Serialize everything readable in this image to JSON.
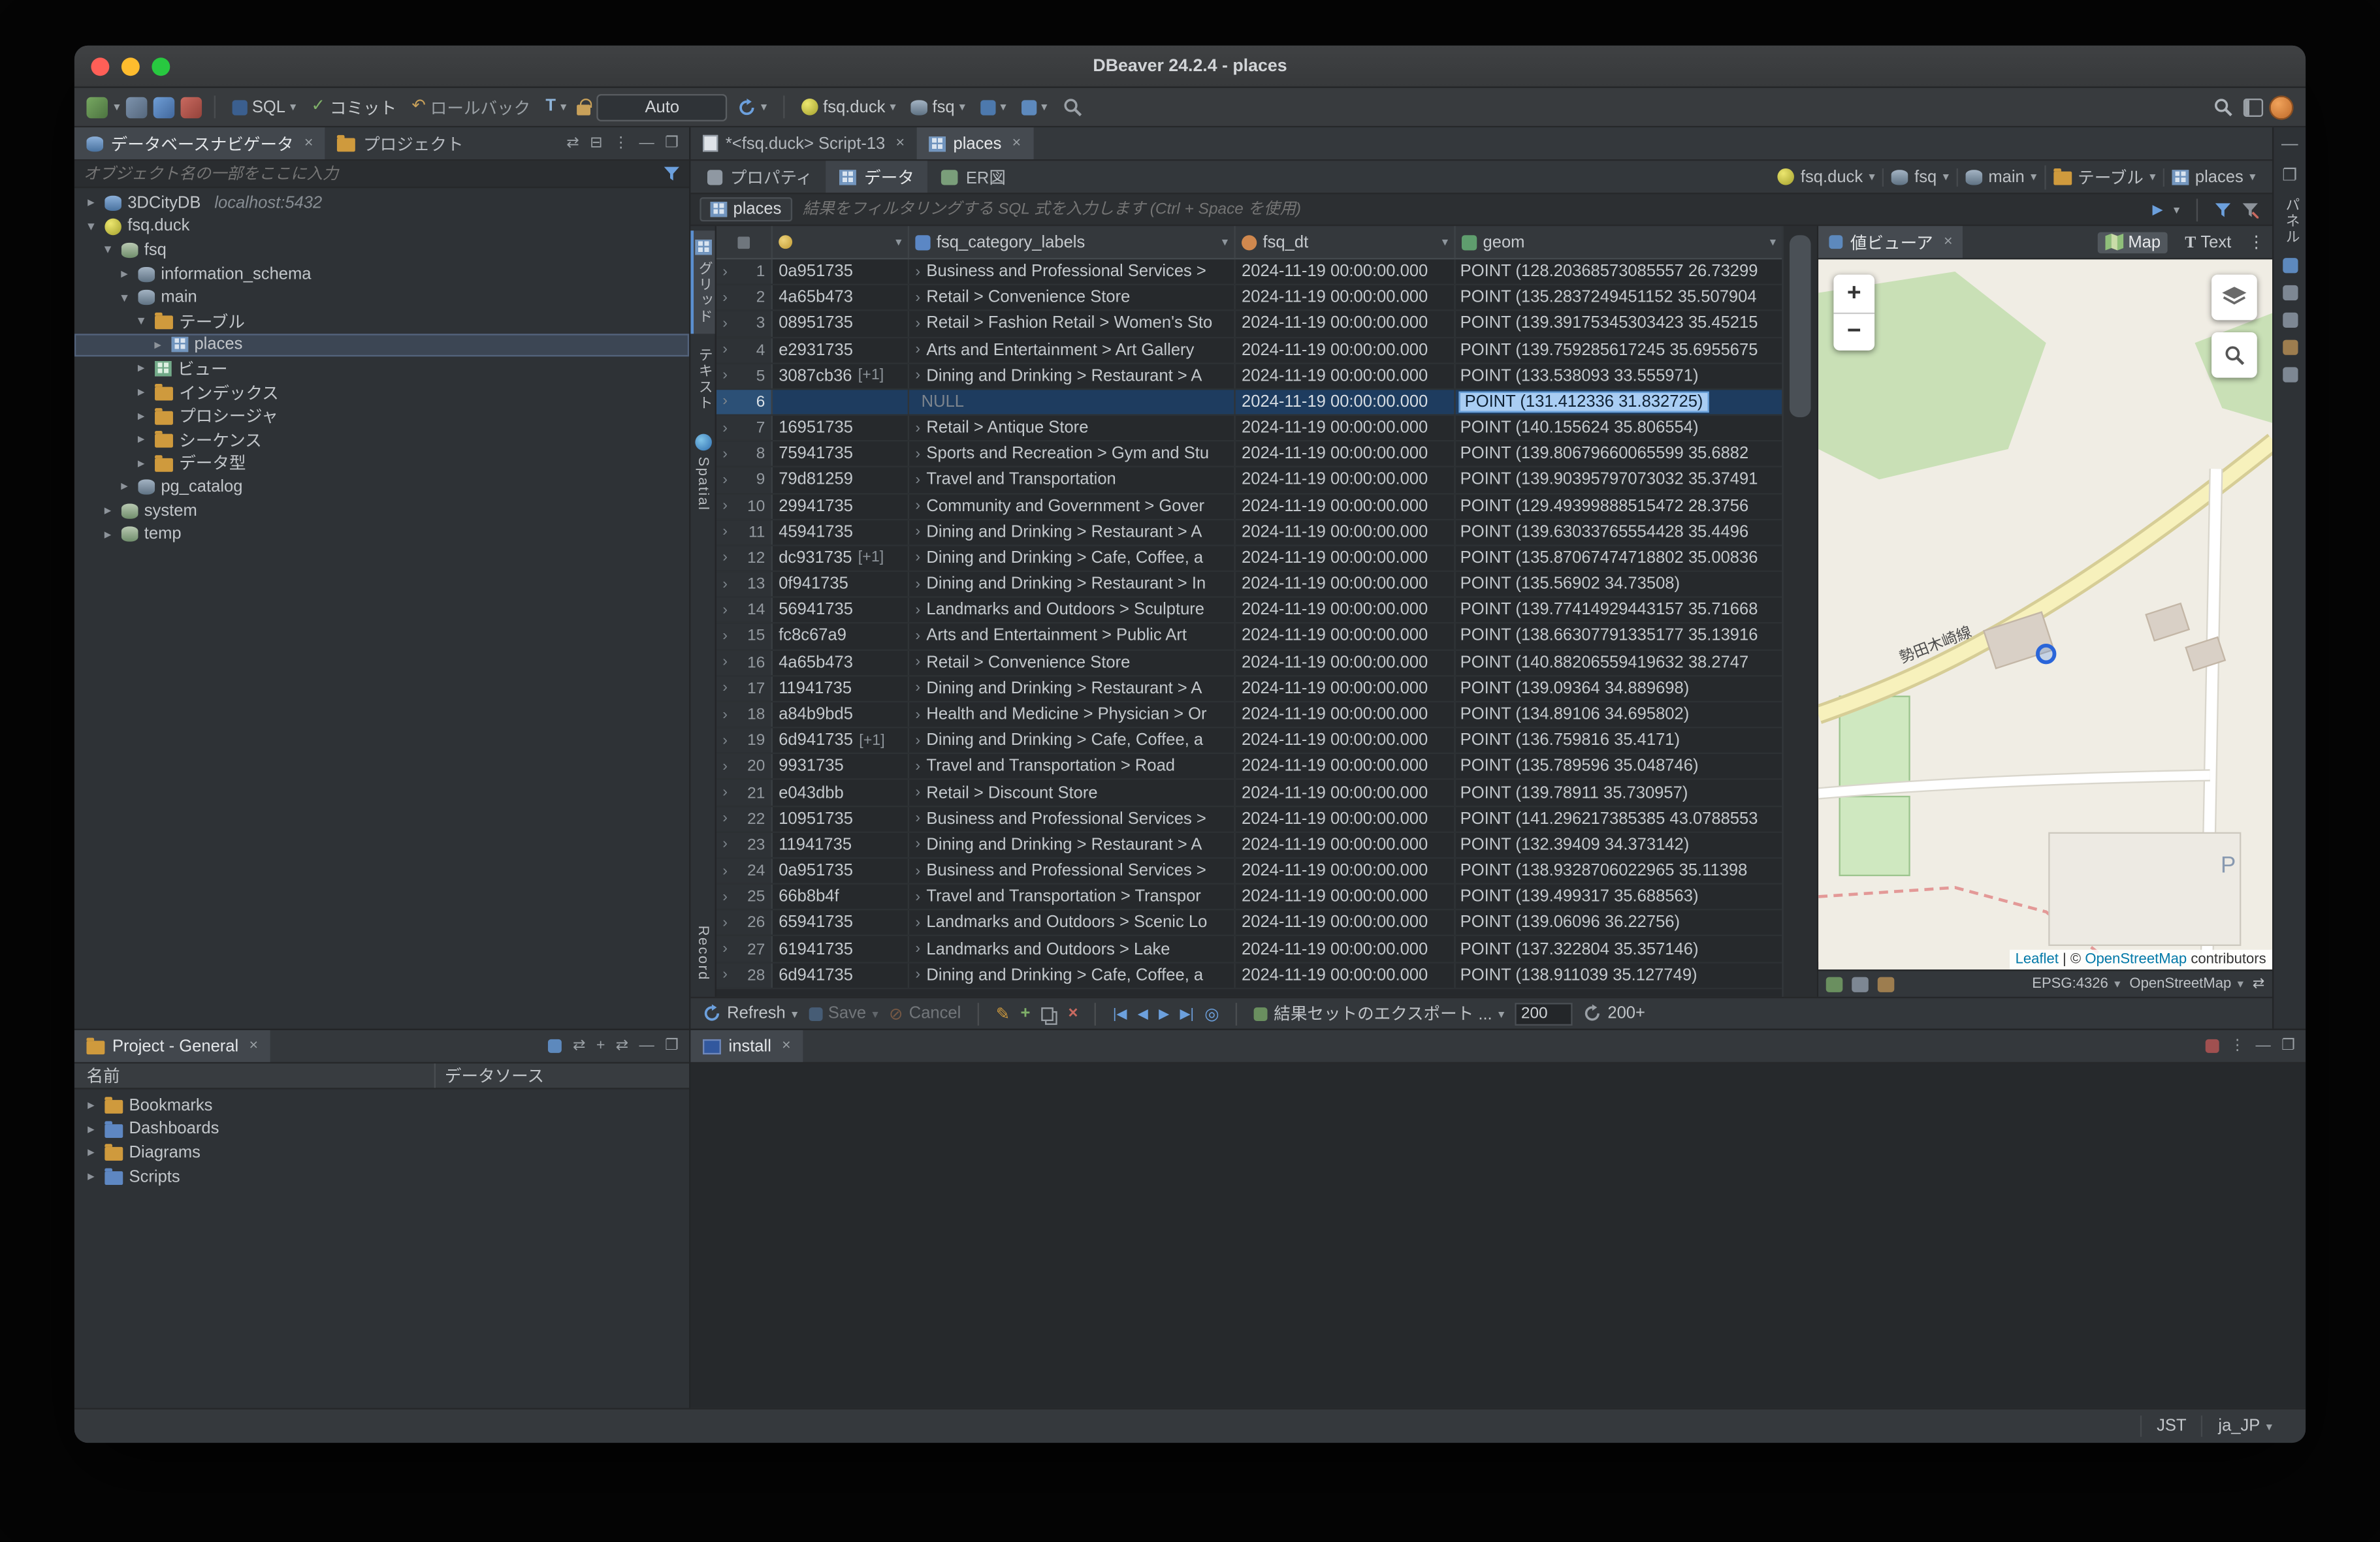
{
  "window": {
    "title": "DBeaver 24.2.4 - places"
  },
  "toolbar": {
    "sql": "SQL",
    "commit": "コミット",
    "rollback": "ロールバック",
    "auto": "Auto",
    "database": "fsq.duck",
    "schema": "fsq"
  },
  "navigator": {
    "tab_database": "データベースナビゲータ",
    "tab_project": "プロジェクト",
    "filter_placeholder": "オブジェクト名の一部をここに入力",
    "tree": [
      {
        "label": "3DCityDB",
        "suffix": "localhost:5432",
        "depth": 0,
        "icon": "db",
        "arrow": "collapsed"
      },
      {
        "label": "fsq.duck",
        "depth": 0,
        "icon": "duck",
        "arrow": "expanded"
      },
      {
        "label": "fsq",
        "depth": 1,
        "icon": "db2",
        "arrow": "expanded"
      },
      {
        "label": "information_schema",
        "depth": 2,
        "icon": "schema",
        "arrow": "collapsed"
      },
      {
        "label": "main",
        "depth": 2,
        "icon": "schema",
        "arrow": "expanded"
      },
      {
        "label": "テーブル",
        "depth": 3,
        "icon": "folder-table",
        "arrow": "expanded"
      },
      {
        "label": "places",
        "depth": 4,
        "icon": "table",
        "arrow": "collapsed",
        "cls": "selected"
      },
      {
        "label": "ビュー",
        "depth": 3,
        "icon": "view",
        "arrow": "collapsed"
      },
      {
        "label": "インデックス",
        "depth": 3,
        "icon": "folder",
        "arrow": "collapsed"
      },
      {
        "label": "プロシージャ",
        "depth": 3,
        "icon": "folder",
        "arrow": "collapsed"
      },
      {
        "label": "シーケンス",
        "depth": 3,
        "icon": "folder",
        "arrow": "collapsed"
      },
      {
        "label": "データ型",
        "depth": 3,
        "icon": "folder",
        "arrow": "collapsed"
      },
      {
        "label": "pg_catalog",
        "depth": 2,
        "icon": "schema",
        "arrow": "collapsed"
      },
      {
        "label": "system",
        "depth": 1,
        "icon": "db2",
        "arrow": "collapsed"
      },
      {
        "label": "temp",
        "depth": 1,
        "icon": "db2",
        "arrow": "collapsed"
      }
    ]
  },
  "editor": {
    "tab_script": "*<fsq.duck> Script-13",
    "tab_places": "places",
    "subtabs": {
      "properties": "プロパティ",
      "data": "データ",
      "er": "ER図"
    },
    "breadcrumb": [
      {
        "label": "fsq.duck",
        "icon": "duck"
      },
      {
        "label": "fsq",
        "icon": "schema"
      },
      {
        "label": "main",
        "icon": "schema"
      },
      {
        "label": "テーブル",
        "icon": "folder-table"
      },
      {
        "label": "places",
        "icon": "table"
      }
    ],
    "filter": {
      "target": "places",
      "placeholder": "結果をフィルタリングする SQL 式を入力します (Ctrl + Space を使用)"
    }
  },
  "grid": {
    "side_tabs": {
      "grid": "グリッド",
      "text": "テキスト",
      "spatial": "Spatial",
      "record": "Record"
    },
    "columns": [
      {
        "name": "",
        "icon": "key"
      },
      {
        "name": "fsq_category_labels",
        "icon": "col-text"
      },
      {
        "name": "fsq_dt",
        "icon": "col-date"
      },
      {
        "name": "geom",
        "icon": "col-geom"
      }
    ],
    "rows": [
      {
        "n": "1",
        "id": "0a951735",
        "badge": "",
        "tw": "›",
        "cat": "Business and Professional Services >",
        "dt": "2024-11-19 00:00:00.000",
        "geom": "POINT (128.20368573085557 26.73299"
      },
      {
        "n": "2",
        "id": "4a65b473",
        "badge": "",
        "tw": "›",
        "cat": "Retail > Convenience Store",
        "dt": "2024-11-19 00:00:00.000",
        "geom": "POINT (135.2837249451152 35.507904"
      },
      {
        "n": "3",
        "id": "08951735",
        "badge": "",
        "tw": "›",
        "cat": "Retail > Fashion Retail > Women's Sto",
        "dt": "2024-11-19 00:00:00.000",
        "geom": "POINT (139.39175345303423 35.45215"
      },
      {
        "n": "4",
        "id": "e2931735",
        "badge": "",
        "tw": "›",
        "cat": "Arts and Entertainment > Art Gallery",
        "dt": "2024-11-19 00:00:00.000",
        "geom": "POINT (139.759285617245 35.6955675"
      },
      {
        "n": "5",
        "id": "3087cb36",
        "badge": "[+1]",
        "tw": "›",
        "cat": "Dining and Drinking > Restaurant > A",
        "dt": "2024-11-19 00:00:00.000",
        "geom": "POINT (133.538093 33.555971)"
      },
      {
        "n": "6",
        "id": "",
        "badge": "",
        "tw": "",
        "cat": "NULL",
        "cat_cls": "null-val",
        "dt": "2024-11-19 00:00:00.000",
        "geom": "POINT (131.412336 31.832725)",
        "cls": "row-selected",
        "geom_cls": "cell-selected"
      },
      {
        "n": "7",
        "id": "16951735",
        "badge": "",
        "tw": "›",
        "cat": "Retail > Antique Store",
        "dt": "2024-11-19 00:00:00.000",
        "geom": "POINT (140.155624 35.806554)"
      },
      {
        "n": "8",
        "id": "75941735",
        "badge": "",
        "tw": "›",
        "cat": "Sports and Recreation > Gym and Stu",
        "dt": "2024-11-19 00:00:00.000",
        "geom": "POINT (139.80679660065599 35.6882"
      },
      {
        "n": "9",
        "id": "79d81259",
        "badge": "",
        "tw": "›",
        "cat": "Travel and Transportation",
        "dt": "2024-11-19 00:00:00.000",
        "geom": "POINT (139.90395797073032 35.37491"
      },
      {
        "n": "10",
        "id": "29941735",
        "badge": "",
        "tw": "›",
        "cat": "Community and Government > Gover",
        "dt": "2024-11-19 00:00:00.000",
        "geom": "POINT (129.49399888515472 28.3756"
      },
      {
        "n": "11",
        "id": "45941735",
        "badge": "",
        "tw": "›",
        "cat": "Dining and Drinking > Restaurant > A",
        "dt": "2024-11-19 00:00:00.000",
        "geom": "POINT (139.63033765554428 35.4496"
      },
      {
        "n": "12",
        "id": "dc931735",
        "badge": "[+1]",
        "tw": "›",
        "cat": "Dining and Drinking > Cafe, Coffee, a",
        "dt": "2024-11-19 00:00:00.000",
        "geom": "POINT (135.87067474718802 35.00836"
      },
      {
        "n": "13",
        "id": "0f941735",
        "badge": "",
        "tw": "›",
        "cat": "Dining and Drinking > Restaurant > In",
        "dt": "2024-11-19 00:00:00.000",
        "geom": "POINT (135.56902 34.73508)"
      },
      {
        "n": "14",
        "id": "56941735",
        "badge": "",
        "tw": "›",
        "cat": "Landmarks and Outdoors > Sculpture",
        "dt": "2024-11-19 00:00:00.000",
        "geom": "POINT (139.77414929443157 35.71668"
      },
      {
        "n": "15",
        "id": "fc8c67a9",
        "badge": "",
        "tw": "›",
        "cat": "Arts and Entertainment > Public Art",
        "dt": "2024-11-19 00:00:00.000",
        "geom": "POINT (138.66307791335177 35.13916"
      },
      {
        "n": "16",
        "id": "4a65b473",
        "badge": "",
        "tw": "›",
        "cat": "Retail > Convenience Store",
        "dt": "2024-11-19 00:00:00.000",
        "geom": "POINT (140.88206559419632 38.2747"
      },
      {
        "n": "17",
        "id": "11941735",
        "badge": "",
        "tw": "›",
        "cat": "Dining and Drinking > Restaurant > A",
        "dt": "2024-11-19 00:00:00.000",
        "geom": "POINT (139.09364 34.889698)"
      },
      {
        "n": "18",
        "id": "a84b9bd5",
        "badge": "",
        "tw": "›",
        "cat": "Health and Medicine > Physician > Or",
        "dt": "2024-11-19 00:00:00.000",
        "geom": "POINT (134.89106 34.695802)"
      },
      {
        "n": "19",
        "id": "6d941735",
        "badge": "[+1]",
        "tw": "›",
        "cat": "Dining and Drinking > Cafe, Coffee, a",
        "dt": "2024-11-19 00:00:00.000",
        "geom": "POINT (136.759816 35.4171)"
      },
      {
        "n": "20",
        "id": "9931735",
        "badge": "",
        "tw": "›",
        "cat": "Travel and Transportation > Road",
        "dt": "2024-11-19 00:00:00.000",
        "geom": "POINT (135.789596 35.048746)"
      },
      {
        "n": "21",
        "id": "e043dbb",
        "badge": "",
        "tw": "›",
        "cat": "Retail > Discount Store",
        "dt": "2024-11-19 00:00:00.000",
        "geom": "POINT (139.78911 35.730957)"
      },
      {
        "n": "22",
        "id": "10951735",
        "badge": "",
        "tw": "›",
        "cat": "Business and Professional Services >",
        "dt": "2024-11-19 00:00:00.000",
        "geom": "POINT (141.296217385385 43.0788553"
      },
      {
        "n": "23",
        "id": "11941735",
        "badge": "",
        "tw": "›",
        "cat": "Dining and Drinking > Restaurant > A",
        "dt": "2024-11-19 00:00:00.000",
        "geom": "POINT (132.39409 34.373142)"
      },
      {
        "n": "24",
        "id": "0a951735",
        "badge": "",
        "tw": "›",
        "cat": "Business and Professional Services >",
        "dt": "2024-11-19 00:00:00.000",
        "geom": "POINT (138.9328706022965 35.11398"
      },
      {
        "n": "25",
        "id": "66b8b4f",
        "badge": "",
        "tw": "›",
        "cat": "Travel and Transportation > Transpor",
        "dt": "2024-11-19 00:00:00.000",
        "geom": "POINT (139.499317 35.688563)"
      },
      {
        "n": "26",
        "id": "65941735",
        "badge": "",
        "tw": "›",
        "cat": "Landmarks and Outdoors > Scenic Lo",
        "dt": "2024-11-19 00:00:00.000",
        "geom": "POINT (139.06096 36.22756)"
      },
      {
        "n": "27",
        "id": "61941735",
        "badge": "",
        "tw": "›",
        "cat": "Landmarks and Outdoors > Lake",
        "dt": "2024-11-19 00:00:00.000",
        "geom": "POINT (137.322804 35.357146)"
      },
      {
        "n": "28",
        "id": "6d941735",
        "badge": "",
        "tw": "›",
        "cat": "Dining and Drinking > Cafe, Coffee, a",
        "dt": "2024-11-19 00:00:00.000",
        "geom": "POINT (138.911039 35.127749)"
      }
    ]
  },
  "grid_toolbar": {
    "refresh": "Refresh",
    "save": "Save",
    "cancel": "Cancel",
    "export": "結果セットのエクスポート ...",
    "fetch_size": "200",
    "fetch_more": "200+"
  },
  "viewer": {
    "tab": "値ビューア",
    "map_button": "Map",
    "text_button": "Text",
    "zoom_in": "+",
    "zoom_out": "−",
    "map": {
      "road_label": "勢田木崎線",
      "parking_label": "P"
    },
    "attribution": {
      "leaflet": "Leaflet",
      "mid": " | © ",
      "osm": "OpenStreetMap",
      "suffix": " contributors"
    },
    "epsg": "EPSG:4326",
    "basemap": "OpenStreetMap"
  },
  "panel_strip": {
    "label": "パネル"
  },
  "project": {
    "tab": "Project - General",
    "columns": {
      "name": "名前",
      "datasource": "データソース"
    },
    "items": [
      {
        "label": "Bookmarks",
        "icon": "folder",
        "arrow": "collapsed",
        "depth": 0
      },
      {
        "label": "Dashboards",
        "icon": "folder-blue",
        "arrow": "collapsed",
        "depth": 0
      },
      {
        "label": "Diagrams",
        "icon": "folder",
        "arrow": "collapsed",
        "depth": 0
      },
      {
        "label": "Scripts",
        "icon": "folder-blue",
        "arrow": "collapsed",
        "depth": 0
      }
    ]
  },
  "install": {
    "tab": "install"
  },
  "statusbar": {
    "timezone": "JST",
    "locale": "ja_JP"
  },
  "icons": {
    "caret-down": "▾",
    "chevron-right": "›",
    "play": "▶",
    "first": "|◀",
    "prev": "◀",
    "next": "▶",
    "last": "▶|",
    "target": "◎",
    "cancel": "⊘",
    "check": "✓",
    "rollback": "↶",
    "swap": "⇄",
    "kebab": "⋮",
    "close": "×",
    "minimize": "—",
    "maximize": "❐",
    "pencil": "✎",
    "plus": "+",
    "delete": "×"
  }
}
